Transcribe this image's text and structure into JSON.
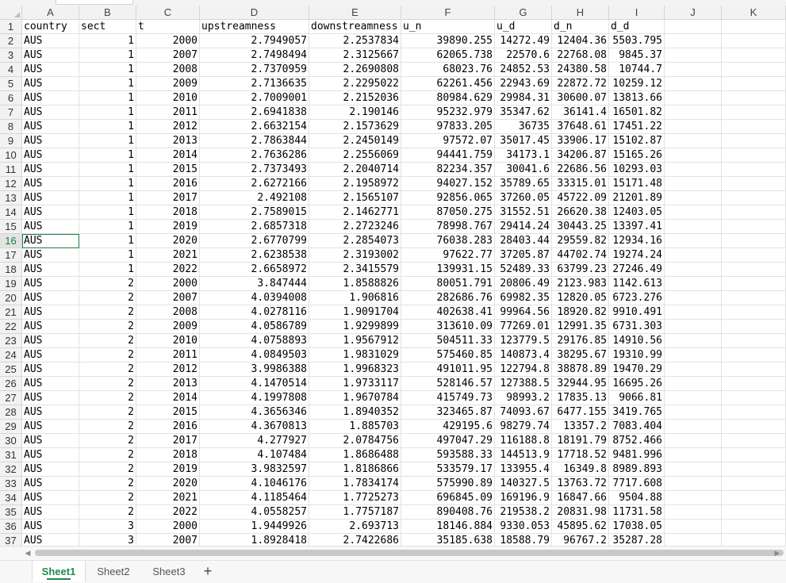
{
  "columns": [
    "A",
    "B",
    "C",
    "D",
    "E",
    "F",
    "G",
    "H",
    "I",
    "J",
    "K"
  ],
  "header_row": [
    "country",
    "sect",
    "t",
    "upstreamness",
    "downstreamness",
    "u_n",
    "u_d",
    "d_n",
    "d_d"
  ],
  "rows": [
    [
      "AUS",
      "1",
      "2000",
      "2.7949057",
      "2.2537834",
      "39890.255",
      "14272.49",
      "12404.36",
      "5503.795"
    ],
    [
      "AUS",
      "1",
      "2007",
      "2.7498494",
      "2.3125667",
      "62065.738",
      "22570.6",
      "22768.08",
      "9845.37"
    ],
    [
      "AUS",
      "1",
      "2008",
      "2.7370959",
      "2.2690808",
      "68023.76",
      "24852.53",
      "24380.58",
      "10744.7"
    ],
    [
      "AUS",
      "1",
      "2009",
      "2.7136635",
      "2.2295022",
      "62261.456",
      "22943.69",
      "22872.72",
      "10259.12"
    ],
    [
      "AUS",
      "1",
      "2010",
      "2.7009001",
      "2.2152036",
      "80984.629",
      "29984.31",
      "30600.07",
      "13813.66"
    ],
    [
      "AUS",
      "1",
      "2011",
      "2.6941838",
      "2.190146",
      "95232.979",
      "35347.62",
      "36141.4",
      "16501.82"
    ],
    [
      "AUS",
      "1",
      "2012",
      "2.6632154",
      "2.1573629",
      "97833.205",
      "36735",
      "37648.61",
      "17451.22"
    ],
    [
      "AUS",
      "1",
      "2013",
      "2.7863844",
      "2.2450149",
      "97572.07",
      "35017.45",
      "33906.17",
      "15102.87"
    ],
    [
      "AUS",
      "1",
      "2014",
      "2.7636286",
      "2.2556069",
      "94441.759",
      "34173.1",
      "34206.87",
      "15165.26"
    ],
    [
      "AUS",
      "1",
      "2015",
      "2.7373493",
      "2.2040714",
      "82234.357",
      "30041.6",
      "22686.56",
      "10293.03"
    ],
    [
      "AUS",
      "1",
      "2016",
      "2.6272166",
      "2.1958972",
      "94027.152",
      "35789.65",
      "33315.01",
      "15171.48"
    ],
    [
      "AUS",
      "1",
      "2017",
      "2.492108",
      "2.1565107",
      "92856.065",
      "37260.05",
      "45722.09",
      "21201.89"
    ],
    [
      "AUS",
      "1",
      "2018",
      "2.7589015",
      "2.1462771",
      "87050.275",
      "31552.51",
      "26620.38",
      "12403.05"
    ],
    [
      "AUS",
      "1",
      "2019",
      "2.6857318",
      "2.2723246",
      "78998.767",
      "29414.24",
      "30443.25",
      "13397.41"
    ],
    [
      "AUS",
      "1",
      "2020",
      "2.6770799",
      "2.2854073",
      "76038.283",
      "28403.44",
      "29559.82",
      "12934.16"
    ],
    [
      "AUS",
      "1",
      "2021",
      "2.6238538",
      "2.3193002",
      "97622.77",
      "37205.87",
      "44702.74",
      "19274.24"
    ],
    [
      "AUS",
      "1",
      "2022",
      "2.6658972",
      "2.3415579",
      "139931.15",
      "52489.33",
      "63799.23",
      "27246.49"
    ],
    [
      "AUS",
      "2",
      "2000",
      "3.847444",
      "1.8588826",
      "80051.791",
      "20806.49",
      "2123.983",
      "1142.613"
    ],
    [
      "AUS",
      "2",
      "2007",
      "4.0394008",
      "1.906816",
      "282686.76",
      "69982.35",
      "12820.05",
      "6723.276"
    ],
    [
      "AUS",
      "2",
      "2008",
      "4.0278116",
      "1.9091704",
      "402638.41",
      "99964.56",
      "18920.82",
      "9910.491"
    ],
    [
      "AUS",
      "2",
      "2009",
      "4.0586789",
      "1.9299899",
      "313610.09",
      "77269.01",
      "12991.35",
      "6731.303"
    ],
    [
      "AUS",
      "2",
      "2010",
      "4.0758893",
      "1.9567912",
      "504511.33",
      "123779.5",
      "29176.85",
      "14910.56"
    ],
    [
      "AUS",
      "2",
      "2011",
      "4.0849503",
      "1.9831029",
      "575460.85",
      "140873.4",
      "38295.67",
      "19310.99"
    ],
    [
      "AUS",
      "2",
      "2012",
      "3.9986388",
      "1.9968323",
      "491011.95",
      "122794.8",
      "38878.89",
      "19470.29"
    ],
    [
      "AUS",
      "2",
      "2013",
      "4.1470514",
      "1.9733117",
      "528146.57",
      "127388.5",
      "32944.95",
      "16695.26"
    ],
    [
      "AUS",
      "2",
      "2014",
      "4.1997808",
      "1.9670784",
      "415749.73",
      "98993.2",
      "17835.13",
      "9066.81"
    ],
    [
      "AUS",
      "2",
      "2015",
      "4.3656346",
      "1.8940352",
      "323465.87",
      "74093.67",
      "6477.155",
      "3419.765"
    ],
    [
      "AUS",
      "2",
      "2016",
      "4.3670813",
      "1.885703",
      "429195.6",
      "98279.74",
      "13357.2",
      "7083.404"
    ],
    [
      "AUS",
      "2",
      "2017",
      "4.277927",
      "2.0784756",
      "497047.29",
      "116188.8",
      "18191.79",
      "8752.466"
    ],
    [
      "AUS",
      "2",
      "2018",
      "4.107484",
      "1.8686488",
      "593588.33",
      "144513.9",
      "17718.52",
      "9481.996"
    ],
    [
      "AUS",
      "2",
      "2019",
      "3.9832597",
      "1.8186866",
      "533579.17",
      "133955.4",
      "16349.8",
      "8989.893"
    ],
    [
      "AUS",
      "2",
      "2020",
      "4.1046176",
      "1.7834174",
      "575990.89",
      "140327.5",
      "13763.72",
      "7717.608"
    ],
    [
      "AUS",
      "2",
      "2021",
      "4.1185464",
      "1.7725273",
      "696845.09",
      "169196.9",
      "16847.66",
      "9504.88"
    ],
    [
      "AUS",
      "2",
      "2022",
      "4.0558257",
      "1.7757187",
      "890408.76",
      "219538.2",
      "20831.98",
      "11731.58"
    ],
    [
      "AUS",
      "3",
      "2000",
      "1.9449926",
      "2.693713",
      "18146.884",
      "9330.053",
      "45895.62",
      "17038.05"
    ],
    [
      "AUS",
      "3",
      "2007",
      "1.8928418",
      "2.7422686",
      "35185.638",
      "18588.79",
      "96767.2",
      "35287.28"
    ]
  ],
  "active_row": 16,
  "sheets": [
    "Sheet1",
    "Sheet2",
    "Sheet3"
  ],
  "active_sheet": "Sheet1",
  "add_sheet_label": "+",
  "colors": {
    "accent": "#1f8a4c",
    "header_bg": "#f2f2f2",
    "gridline": "#e2e2e2"
  }
}
